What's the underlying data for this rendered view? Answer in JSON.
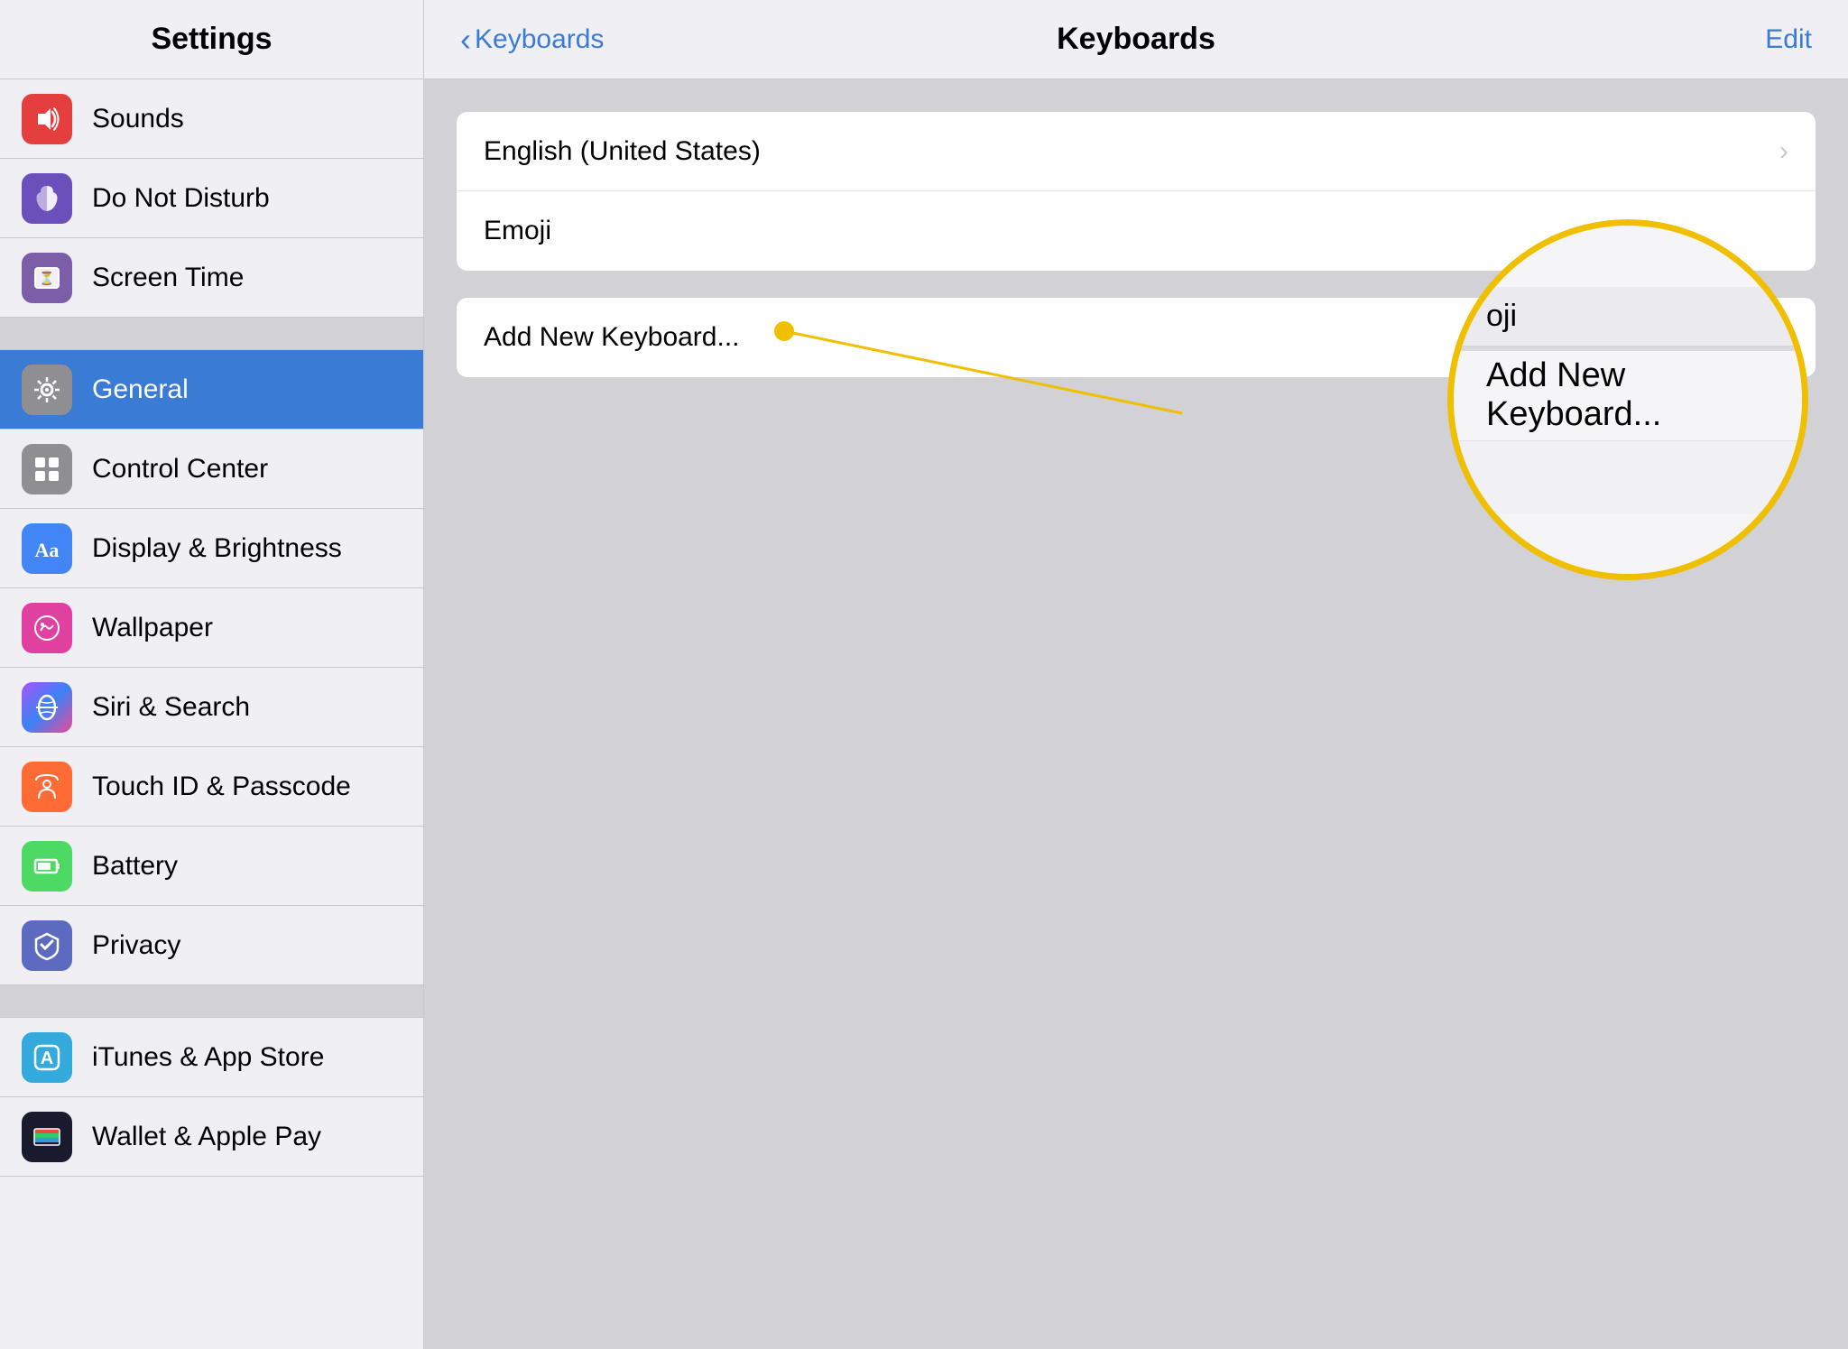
{
  "sidebar": {
    "title": "Settings",
    "items": [
      {
        "id": "sounds",
        "label": "Sounds",
        "icon": "🔊",
        "iconBg": "icon-red",
        "active": false
      },
      {
        "id": "do-not-disturb",
        "label": "Do Not Disturb",
        "icon": "🌙",
        "iconBg": "icon-purple",
        "active": false
      },
      {
        "id": "screen-time",
        "label": "Screen Time",
        "icon": "⏳",
        "iconBg": "icon-purple2",
        "active": false
      },
      {
        "id": "general",
        "label": "General",
        "icon": "⚙️",
        "iconBg": "icon-gray",
        "active": true
      },
      {
        "id": "control-center",
        "label": "Control Center",
        "icon": "⊞",
        "iconBg": "icon-gray",
        "active": false
      },
      {
        "id": "display",
        "label": "Display & Brightness",
        "icon": "Aa",
        "iconBg": "icon-blue",
        "active": false
      },
      {
        "id": "wallpaper",
        "label": "Wallpaper",
        "icon": "🌸",
        "iconBg": "icon-pink",
        "active": false
      },
      {
        "id": "siri",
        "label": "Siri & Search",
        "icon": "✦",
        "iconBg": "icon-teal",
        "active": false
      },
      {
        "id": "touch-id",
        "label": "Touch ID & Passcode",
        "icon": "👆",
        "iconBg": "icon-orange",
        "active": false
      },
      {
        "id": "battery",
        "label": "Battery",
        "icon": "🔋",
        "iconBg": "icon-green",
        "active": false
      },
      {
        "id": "privacy",
        "label": "Privacy",
        "icon": "✋",
        "iconBg": "icon-blue3",
        "active": false
      }
    ],
    "section2": [
      {
        "id": "itunes",
        "label": "iTunes & App Store",
        "icon": "🅰️",
        "iconBg": "icon-blue2",
        "active": false
      },
      {
        "id": "wallet",
        "label": "Wallet & Apple Pay",
        "icon": "💳",
        "iconBg": "icon-green2",
        "active": false
      }
    ]
  },
  "right": {
    "back_label": "Keyboards",
    "title": "Keyboards",
    "edit_label": "Edit",
    "keyboards": [
      {
        "label": "English (United States)",
        "has_chevron": true
      },
      {
        "label": "Emoji",
        "has_chevron": false
      }
    ],
    "add_keyboard_label": "Add New Keyboard...",
    "magnified_top_partial": "oji",
    "magnified_main": "Add New Keyboard...",
    "annotation_dot_color": "#f0c000"
  }
}
